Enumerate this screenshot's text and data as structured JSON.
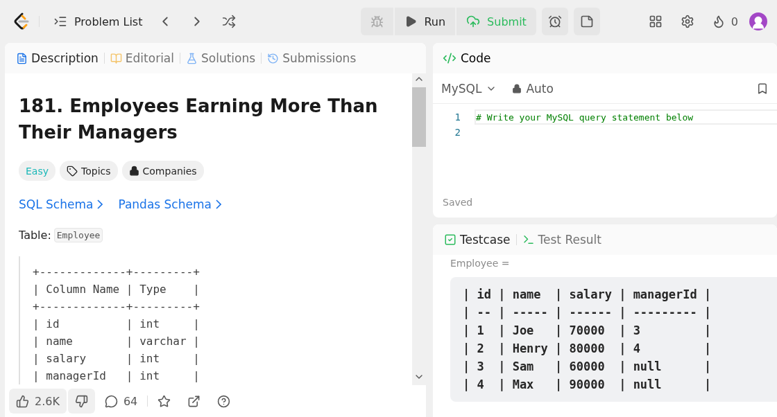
{
  "topbar": {
    "problem_list": "Problem List",
    "run": "Run",
    "submit": "Submit",
    "streak": "0"
  },
  "left_panel": {
    "tabs": [
      {
        "label": "Description",
        "selected": true
      },
      {
        "label": "Editorial",
        "selected": false
      },
      {
        "label": "Solutions",
        "selected": false
      },
      {
        "label": "Submissions",
        "selected": false
      }
    ],
    "title": "181. Employees Earning More Than Their Managers",
    "tags": [
      {
        "kind": "difficulty",
        "label": "Easy"
      },
      {
        "kind": "topics",
        "label": "Topics"
      },
      {
        "kind": "companies",
        "label": "Companies"
      }
    ],
    "links": [
      "SQL Schema",
      "Pandas Schema"
    ],
    "table_label": "Table:",
    "table_name": "Employee",
    "schema_lines": [
      "+-------------+---------+",
      "| Column Name | Type    |",
      "+-------------+---------+",
      "| id          | int     |",
      "| name        | varchar |",
      "| salary      | int     |",
      "| managerId   | int     |"
    ],
    "footer": {
      "likes": "2.6K",
      "comments": "64"
    }
  },
  "code_panel": {
    "title": "Code",
    "language": "MySQL",
    "mode": "Auto",
    "lines": [
      {
        "number": "1",
        "text": "# Write your MySQL query statement below"
      },
      {
        "number": "2"
      }
    ],
    "status": "Saved"
  },
  "test_panel": {
    "tabs": [
      {
        "label": "Testcase",
        "selected": true
      },
      {
        "label": "Test Result",
        "selected": false
      }
    ],
    "input_label": "Employee =",
    "input_lines": [
      "| id | name  | salary | managerId |",
      "| -- | ----- | ------ | --------- |",
      "| 1  | Joe   | 70000  | 3         |",
      "| 2  | Henry | 80000  | 4         |",
      "| 3  | Sam   | 60000  | null      |",
      "| 4  | Max   | 90000  | null      |"
    ]
  }
}
